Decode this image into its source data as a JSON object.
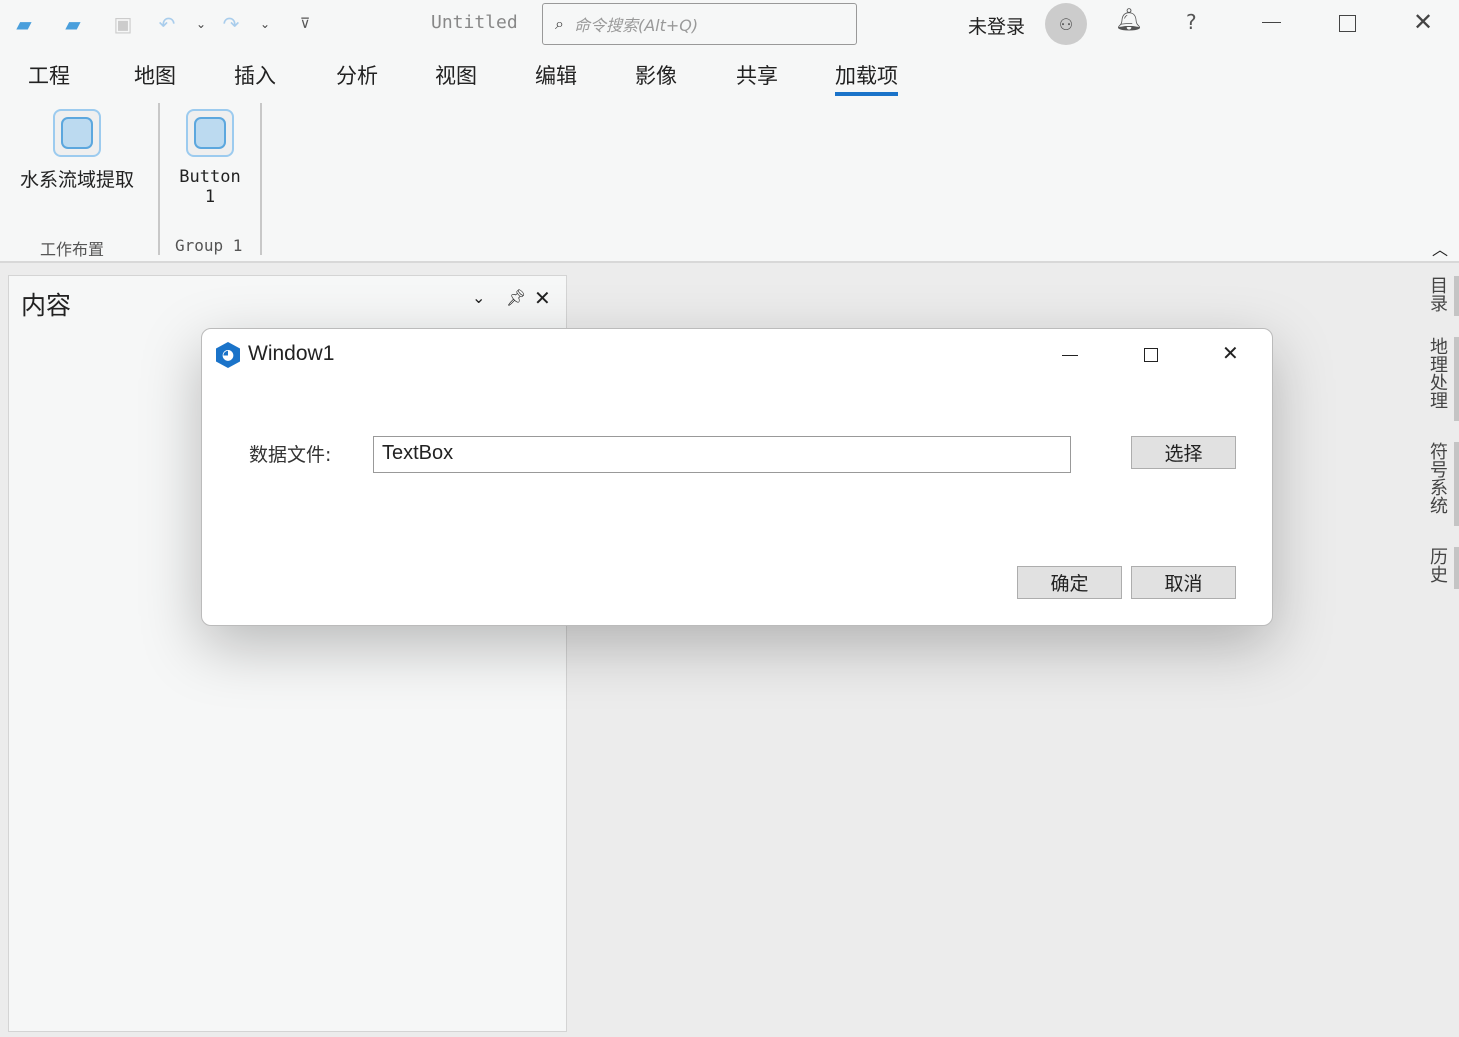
{
  "app": {
    "title": "Untitled",
    "search_placeholder": "命令搜索(Alt+Q)",
    "user": "未登录",
    "help": "?"
  },
  "tabs": [
    "工程",
    "地图",
    "插入",
    "分析",
    "视图",
    "编辑",
    "影像",
    "共享",
    "加载项"
  ],
  "active_tab": "加载项",
  "ribbon": {
    "groups": [
      {
        "label": "工作布置",
        "button": "水系流域提取"
      },
      {
        "label": "Group 1",
        "button_line1": "Button",
        "button_line2": "1"
      }
    ]
  },
  "pane": {
    "title": "内容"
  },
  "side_tabs": [
    "目录",
    "地理处理",
    "符号系统",
    "历史"
  ],
  "dialog": {
    "title": "Window1",
    "field_label": "数据文件:",
    "field_value": "TextBox",
    "browse": "选择",
    "ok": "确定",
    "cancel": "取消"
  },
  "colors": {
    "accent": "#1a73c9"
  }
}
